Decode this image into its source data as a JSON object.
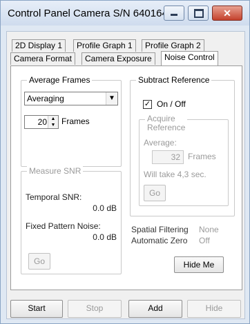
{
  "window": {
    "title": "Control Panel Camera S/N 640164",
    "close_symbol": "✕"
  },
  "tabs": {
    "row1": [
      "2D Display 1",
      "Profile Graph 1",
      "Profile Graph 2"
    ],
    "row2": [
      "Camera Format",
      "Camera Exposure",
      "Noise Control"
    ],
    "active": "Noise Control"
  },
  "average_frames": {
    "title": "Average Frames",
    "mode": "Averaging",
    "frames_value": "20",
    "frames_label": "Frames"
  },
  "subtract_reference": {
    "title": "Subtract Reference",
    "onoff_label": "On / Off",
    "checked": true,
    "acquire_title": "Acquire Reference",
    "acquire_title_line1": "Acquire",
    "acquire_title_line2": "Reference",
    "average_label": "Average:",
    "average_value": "32",
    "frames_label": "Frames",
    "will_take": "Will take 4,3 sec.",
    "go_label": "Go"
  },
  "measure_snr": {
    "title": "Measure SNR",
    "temporal_label": "Temporal SNR:",
    "temporal_value": "0.0 dB",
    "fixed_label": "Fixed Pattern Noise:",
    "fixed_value": "0.0 dB",
    "go_label": "Go"
  },
  "info": {
    "spatial_label": "Spatial Filtering",
    "spatial_value": "None",
    "autozero_label": "Automatic Zero",
    "autozero_value": "Off"
  },
  "buttons": {
    "hide_me": "Hide Me",
    "start": "Start",
    "stop": "Stop",
    "add": "Add",
    "hide": "Hide"
  }
}
